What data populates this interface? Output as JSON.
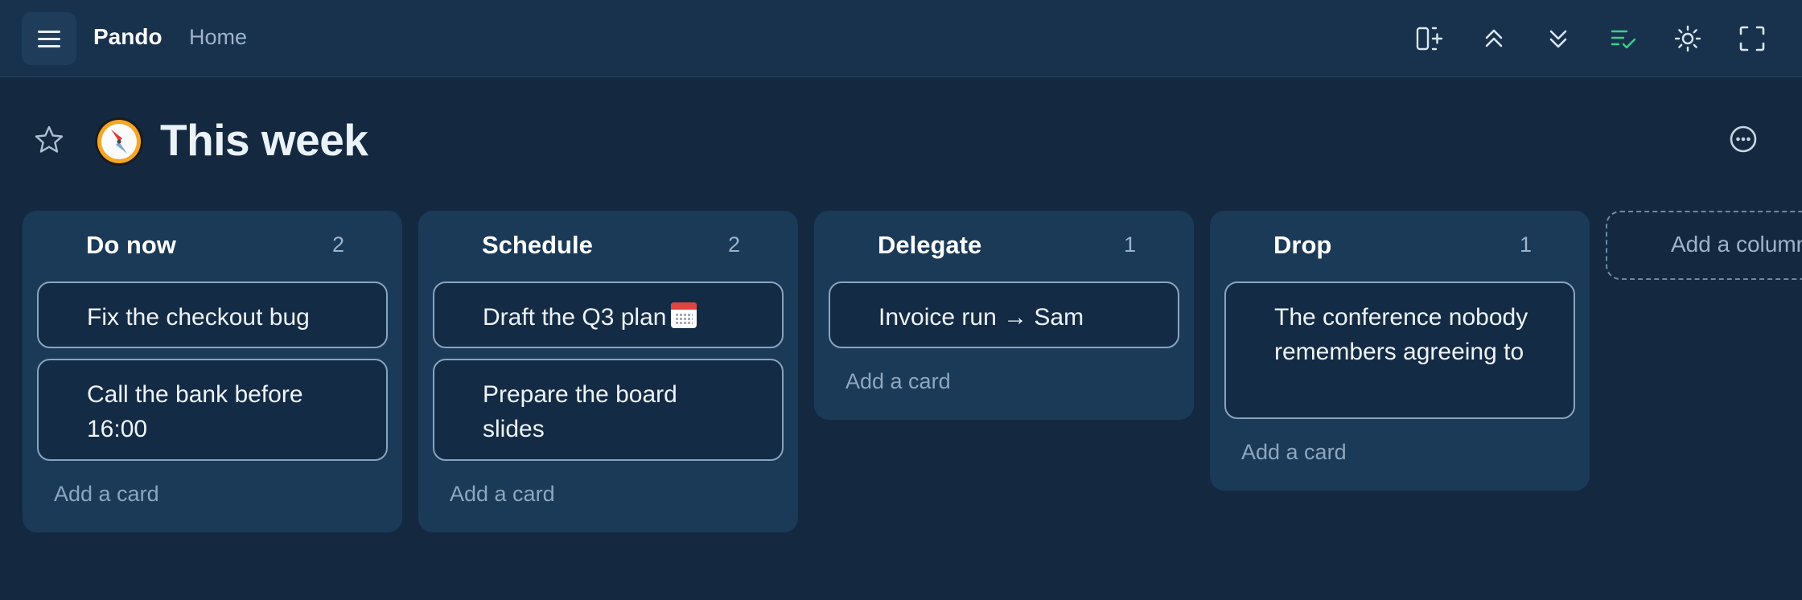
{
  "app": {
    "name": "Pando",
    "breadcrumb": "Home"
  },
  "toolbar": {
    "icons": [
      "add-column-icon",
      "collapse-all-icon",
      "expand-all-icon",
      "checklist-icon",
      "brightness-icon",
      "fullscreen-icon"
    ]
  },
  "page": {
    "title": "This week",
    "emoji_icon": "compass-icon"
  },
  "columns": [
    {
      "title": "Do now",
      "count": "2",
      "cards": [
        "Fix the checkout bug",
        "Call the bank before 16:00"
      ],
      "add_label": "Add a card"
    },
    {
      "title": "Schedule",
      "count": "2",
      "cards": [
        "Draft the Q3 plan",
        "Prepare the board slides"
      ],
      "add_label": "Add a card"
    },
    {
      "title": "Delegate",
      "count": "1",
      "cards": [
        "Invoice run → Sam"
      ],
      "add_label": "Add a card"
    },
    {
      "title": "Drop",
      "count": "1",
      "cards": [
        "The conference nobody remembers agreeing to"
      ],
      "add_label": "Add a card"
    }
  ],
  "add_column_label": "Add a column",
  "colors": {
    "background": "#142940",
    "column": "#1a3a58",
    "card": "#142b45",
    "accent_green": "#3ecf8e"
  }
}
